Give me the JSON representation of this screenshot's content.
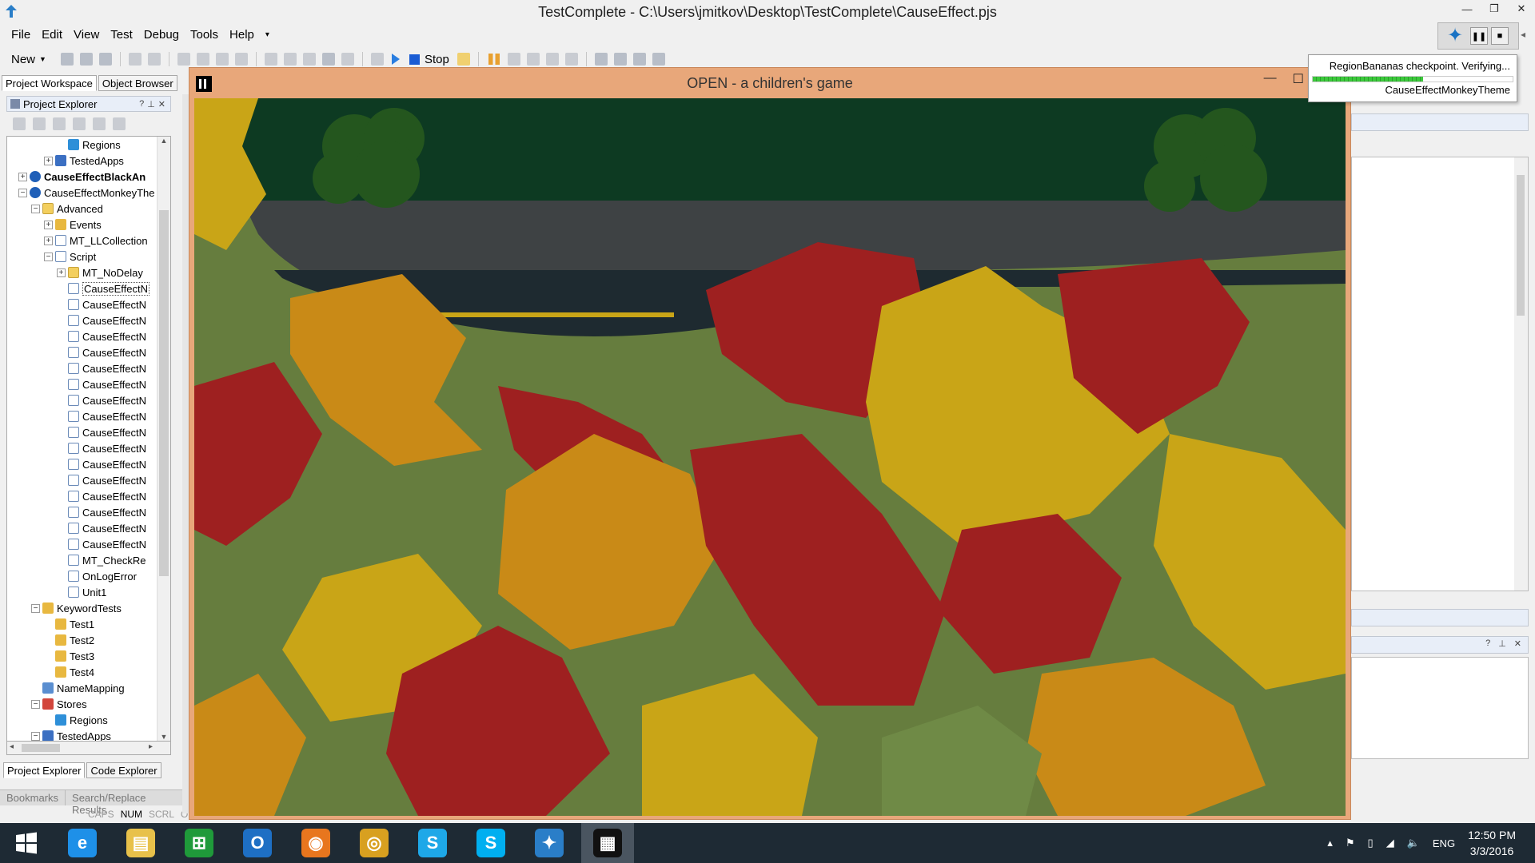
{
  "window": {
    "title": "TestComplete - C:\\Users\\jmitkov\\Desktop\\TestComplete\\CauseEffect.pjs"
  },
  "menu": [
    "File",
    "Edit",
    "View",
    "Test",
    "Debug",
    "Tools",
    "Help"
  ],
  "toolbar": {
    "new_label": "New",
    "stop_label": "Stop"
  },
  "left_panel": {
    "top_tabs": [
      "Project Workspace",
      "Object Browser"
    ],
    "header": "Project Explorer",
    "bottom_tabs": [
      "Project Explorer",
      "Code Explorer"
    ],
    "tree": [
      {
        "label": "Regions",
        "icon": "region-icon"
      },
      {
        "label": "TestedApps",
        "icon": "tested-apps-icon"
      },
      {
        "label": "CauseEffectBlackAn",
        "icon": "project-icon",
        "bold": true
      },
      {
        "label": "CauseEffectMonkeyThe",
        "icon": "project-icon"
      },
      {
        "label": "Advanced",
        "icon": "folder-icon"
      },
      {
        "label": "Events",
        "icon": "events-icon"
      },
      {
        "label": "MT_LLCollection",
        "icon": "collection-icon"
      },
      {
        "label": "Script",
        "icon": "script-icon"
      },
      {
        "label": "MT_NoDelay",
        "icon": "folder-icon"
      },
      {
        "label": "CauseEffectN",
        "icon": "unit-icon",
        "selected": true
      },
      {
        "label": "CauseEffectN",
        "icon": "unit-icon"
      },
      {
        "label": "CauseEffectN",
        "icon": "unit-icon"
      },
      {
        "label": "CauseEffectN",
        "icon": "unit-icon"
      },
      {
        "label": "CauseEffectN",
        "icon": "unit-icon"
      },
      {
        "label": "CauseEffectN",
        "icon": "unit-icon"
      },
      {
        "label": "CauseEffectN",
        "icon": "unit-icon"
      },
      {
        "label": "CauseEffectN",
        "icon": "unit-icon"
      },
      {
        "label": "CauseEffectN",
        "icon": "unit-icon"
      },
      {
        "label": "CauseEffectN",
        "icon": "unit-icon"
      },
      {
        "label": "CauseEffectN",
        "icon": "unit-icon"
      },
      {
        "label": "CauseEffectN",
        "icon": "unit-icon"
      },
      {
        "label": "CauseEffectN",
        "icon": "unit-icon"
      },
      {
        "label": "CauseEffectN",
        "icon": "unit-icon"
      },
      {
        "label": "CauseEffectN",
        "icon": "unit-icon"
      },
      {
        "label": "CauseEffectN",
        "icon": "unit-icon"
      },
      {
        "label": "CauseEffectN",
        "icon": "unit-icon"
      },
      {
        "label": "MT_CheckRe",
        "icon": "unit-icon"
      },
      {
        "label": "OnLogError",
        "icon": "unit-icon"
      },
      {
        "label": "Unit1",
        "icon": "unit-icon"
      },
      {
        "label": "KeywordTests",
        "icon": "keyword-tests-icon"
      },
      {
        "label": "Test1",
        "icon": "keyword-test-icon"
      },
      {
        "label": "Test2",
        "icon": "keyword-test-icon"
      },
      {
        "label": "Test3",
        "icon": "keyword-test-icon"
      },
      {
        "label": "Test4",
        "icon": "keyword-test-icon"
      },
      {
        "label": "NameMapping",
        "icon": "name-mapping-icon"
      },
      {
        "label": "Stores",
        "icon": "stores-icon"
      },
      {
        "label": "Regions",
        "icon": "region-icon"
      },
      {
        "label": "TestedApps",
        "icon": "tested-apps-icon"
      }
    ]
  },
  "lower_tabs": [
    "Bookmarks",
    "Search/Replace Results"
  ],
  "status": {
    "caps": "CAPS",
    "num": "NUM",
    "scrl": "SCRL",
    "ovr": "O"
  },
  "checkpoint_popup": {
    "message": "RegionBananas checkpoint. Verifying...",
    "target": "CauseEffectMonkeyTheme",
    "progress": 0.55
  },
  "game_window": {
    "title": "OPEN - a children's game"
  },
  "taskbar": {
    "apps": [
      {
        "name": "internet-explorer-icon",
        "glyph": "e",
        "color": "#1e90e8"
      },
      {
        "name": "file-explorer-icon",
        "glyph": "▤",
        "color": "#e8c14a"
      },
      {
        "name": "store-icon",
        "glyph": "⊞",
        "color": "#1f9a3a"
      },
      {
        "name": "outlook-icon",
        "glyph": "O",
        "color": "#1e6fc4"
      },
      {
        "name": "firefox-icon",
        "glyph": "◉",
        "color": "#e8761e"
      },
      {
        "name": "chrome-icon",
        "glyph": "◎",
        "color": "#d8a020"
      },
      {
        "name": "skype-business-icon",
        "glyph": "S",
        "color": "#1ea8e8"
      },
      {
        "name": "skype-icon",
        "glyph": "S",
        "color": "#00aff0"
      },
      {
        "name": "testcomplete-icon",
        "glyph": "✦",
        "color": "#2a7ec8"
      },
      {
        "name": "open-game-icon",
        "glyph": "▦",
        "color": "#111111",
        "active": true
      }
    ],
    "language": "ENG",
    "time": "12:50 PM",
    "date": "3/3/2016"
  },
  "colors": {
    "leaf_red": "#9e2020",
    "leaf_yellow": "#c9a517",
    "leaf_green": "#6f8a46",
    "leaf_orange": "#c98a17"
  }
}
